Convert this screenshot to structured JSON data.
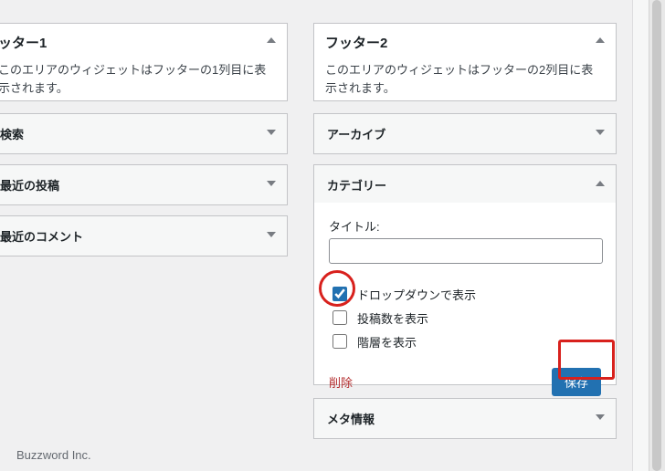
{
  "left": {
    "title": "ッター1",
    "desc": "このエリアのウィジェットはフッターの1列目に表示されます。",
    "items": [
      {
        "label": "検索"
      },
      {
        "label": "最近の投稿"
      },
      {
        "label": "最近のコメント"
      }
    ]
  },
  "right": {
    "title": "フッター2",
    "desc": "このエリアのウィジェットはフッターの2列目に表示されます。",
    "archive_label": "アーカイブ",
    "category_label": "カテゴリー",
    "meta_label": "メタ情報",
    "category_form": {
      "title_label": "タイトル:",
      "title_value": "",
      "dropdown_label": "ドロップダウンで表示",
      "dropdown_checked": true,
      "count_label": "投稿数を表示",
      "count_checked": false,
      "hier_label": "階層を表示",
      "hier_checked": false,
      "delete_label": "削除",
      "save_label": "保存"
    }
  },
  "credit": "Buzzword Inc."
}
